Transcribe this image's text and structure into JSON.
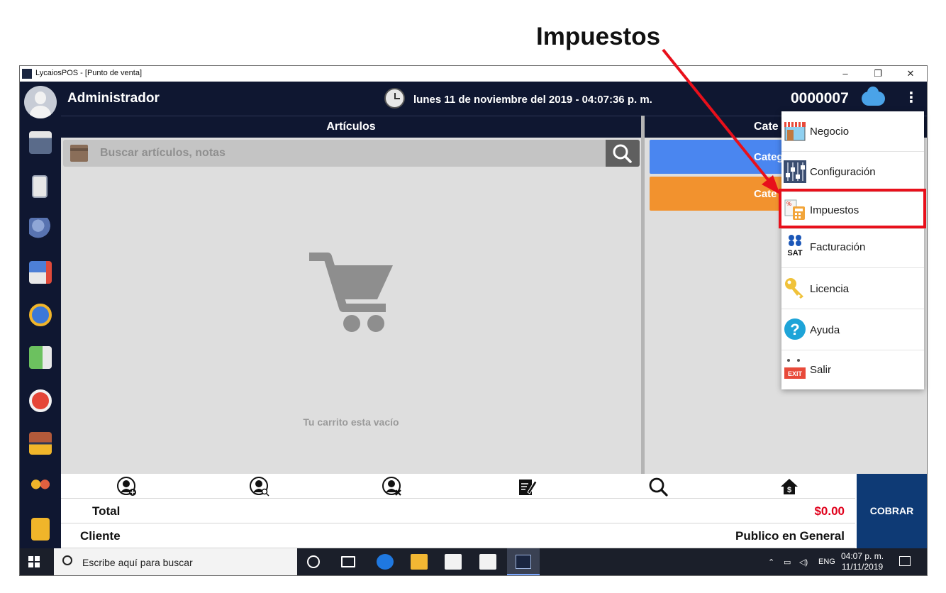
{
  "annotation": {
    "title": "Impuestos"
  },
  "window": {
    "title": "LycaiosPOS - [Punto de venta]",
    "minimize": "–",
    "restore": "❐",
    "close": "✕"
  },
  "header": {
    "user": "Administrador",
    "datetime": "lunes 11 de noviembre del 2019 - 04:07:36 p. m.",
    "ticket": "0000007",
    "menu_glyph": "⋮"
  },
  "articles": {
    "title": "Artículos",
    "search_placeholder": "Buscar artículos, notas",
    "empty_text": "Tu carrito esta vacío"
  },
  "categories": {
    "title": "Cate",
    "buttons": [
      {
        "label": "Categ",
        "color": "#4a86f0"
      },
      {
        "label": "Cate",
        "color": "#f2922e"
      }
    ]
  },
  "summary": {
    "total_label": "Total",
    "total_value": "$0.00",
    "client_label": "Cliente",
    "client_value": "Publico en General",
    "pay_button": "COBRAR"
  },
  "menu": {
    "items": [
      {
        "id": "negocio",
        "label": "Negocio",
        "icon": "store-icon"
      },
      {
        "id": "configuracion",
        "label": "Configuración",
        "icon": "sliders-icon"
      },
      {
        "id": "impuestos",
        "label": "Impuestos",
        "icon": "calculator-icon"
      },
      {
        "id": "facturacion",
        "label": "Facturación",
        "icon": "sat-icon",
        "icon_text": "SAT"
      },
      {
        "id": "licencia",
        "label": "Licencia",
        "icon": "key-icon"
      },
      {
        "id": "ayuda",
        "label": "Ayuda",
        "icon": "help-icon",
        "icon_text": "?"
      },
      {
        "id": "salir",
        "label": "Salir",
        "icon": "exit-icon",
        "icon_text": "EXIT"
      }
    ]
  },
  "taskbar": {
    "search_placeholder": "Escribe aquí para buscar",
    "lang": "ENG",
    "time": "04:07 p. m.",
    "date": "11/11/2019"
  },
  "colors": {
    "navy": "#0f1731",
    "accent_red": "#e8101b",
    "total_red": "#e0001b",
    "pay_blue": "#0e3a75"
  }
}
